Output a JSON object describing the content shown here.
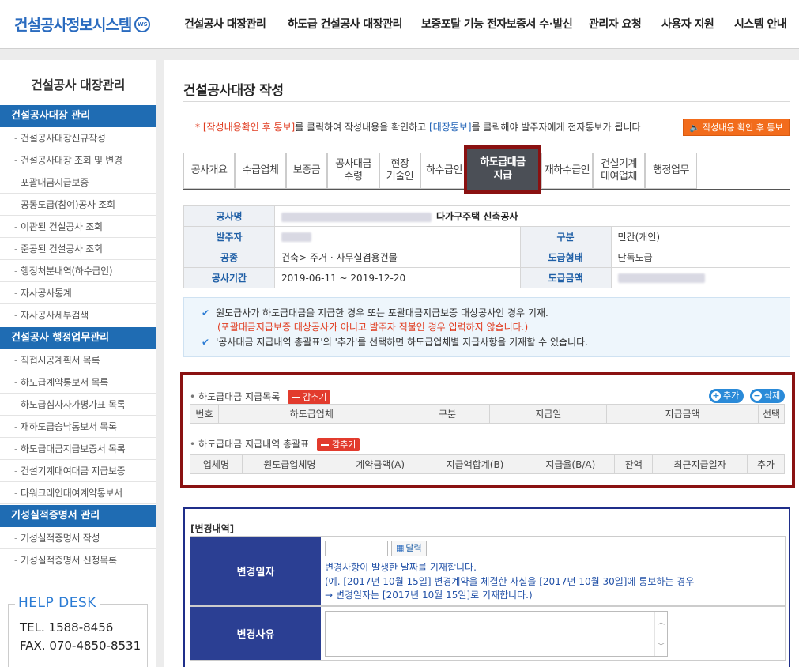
{
  "header": {
    "logo_text": "건설공사정보시스템",
    "logo_badge": "WS",
    "nav": [
      "건설공사 대장관리",
      "하도급 건설공사 대장관리",
      "보증포탈 기능 전자보증서 수·발신",
      "관리자 요청",
      "사용자 지원",
      "시스템 안내"
    ]
  },
  "sidebar": {
    "title": "건설공사 대장관리",
    "sections": [
      {
        "label": "건설공사대장 관리",
        "items": [
          "건설공사대장신규작성",
          "건설공사대장 조회 및 변경",
          "포괄대금지급보증",
          "공동도급(참여)공사 조회",
          "이관된 건설공사 조회",
          "준공된 건설공사 조회",
          "행정처분내역(하수급인)",
          "자사공사통계",
          "자사공사세부검색"
        ]
      },
      {
        "label": "건설공사 행정업무관리",
        "items": [
          "직접시공계획서 목록",
          "하도급계약통보서 목록",
          "하도급심사자가평가표 목록",
          "재하도급승낙통보서 목록",
          "하도급대금지급보증서 목록",
          "건설기계대여대금 지급보증",
          "타워크레인대여계약통보서"
        ]
      },
      {
        "label": "기성실적증명서 관리",
        "items": [
          "기성실적증명서 작성",
          "기성실적증명서 신청목록"
        ]
      }
    ],
    "helpdesk": {
      "title": "HELP DESK",
      "tel": "TEL. 1588-8456",
      "fax": "FAX. 070-4850-8531"
    }
  },
  "main": {
    "page_title": "건설공사대장 작성",
    "notice": {
      "prefix": "* ",
      "link1": "[작성내용확인 후 통보]",
      "mid": "를 클릭하여 작성내용을 확인하고 ",
      "link2": "[대장통보]",
      "suffix": "를 클릭해야 발주자에게 전자통보가 됩니다",
      "button": "작성내용 확인 후 통보"
    },
    "tabs": [
      {
        "label": "공사개요"
      },
      {
        "label": "수급업체"
      },
      {
        "label": "보증금"
      },
      {
        "label": "공사대금\n수령"
      },
      {
        "label": "현장\n기술인"
      },
      {
        "label": "하수급인"
      },
      {
        "label": "하도급대금\n지급",
        "active": true
      },
      {
        "label": "재하수급인"
      },
      {
        "label": "건설기계\n대여업체"
      },
      {
        "label": "행정업무"
      }
    ],
    "info": {
      "project_label": "공사명",
      "project_name": "다가구주택 신축공사",
      "client_label": "발주자",
      "division_label": "구분",
      "division_value": "민간(개인)",
      "work_type_label": "공종",
      "work_type_value": "건축> 주거 · 사무실겸용건물",
      "contract_type_label": "도급형태",
      "contract_type_value": "단독도급",
      "period_label": "공사기간",
      "period_value": "2019-06-11 ~ 2019-12-20",
      "amount_label": "도급금액"
    },
    "guide": {
      "line1": "원도급사가 하도급대금을 지급한 경우 또는 포괄대금지급보증 대상공사인 경우 기재.",
      "line2": "(포괄대금지급보증 대상공사가 아니고 발주자 직불인 경우 입력하지 않습니다.)",
      "line3": "'공사대금 지급내역 총괄표'의 '추가'를 선택하면 하도급업체별 지급사항을 기재할 수 있습니다."
    },
    "payment_list": {
      "title": "하도급대금 지급목록",
      "hide_btn": "감추기",
      "add_btn": "추가",
      "delete_btn": "삭제",
      "columns": [
        "번호",
        "하도급업체",
        "구분",
        "지급일",
        "지급금액",
        "선택"
      ]
    },
    "payment_summary": {
      "title": "하도급대금 지급내역 총괄표",
      "hide_btn": "감추기",
      "columns": [
        "업체명",
        "원도급업체명",
        "계약금액(A)",
        "지급액합계(B)",
        "지급율(B/A)",
        "잔액",
        "최근지급일자",
        "추가"
      ]
    },
    "change": {
      "title": "[변경내역]",
      "date_label": "변경일자",
      "calendar_btn": "달력",
      "date_help1": "변경사항이 발생한 날짜를 기재합니다.",
      "date_help2": "(예. [2017년 10월 15일] 변경계약을 체결한 사실을 [2017년 10월 30일]에 통보하는 경우",
      "date_help3": "→ 변경일자는 [2017년 10월 15일]로 기재합니다.)",
      "reason_label": "변경사유",
      "date_value": "",
      "reason_value": ""
    }
  }
}
